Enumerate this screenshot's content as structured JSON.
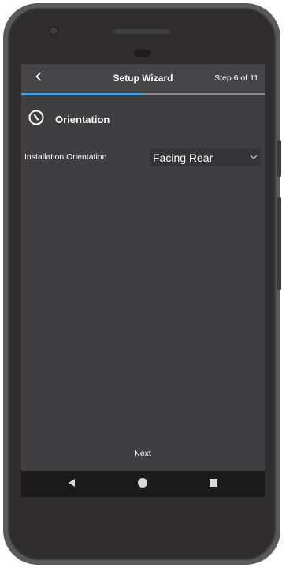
{
  "header": {
    "title": "Setup Wizard",
    "step": "Step 6 of 11",
    "back_icon": "chevron-left-icon"
  },
  "progress": {
    "current_step": 6,
    "total_steps": 11,
    "fraction": 0.5,
    "fill_color": "#4a9fd8"
  },
  "section": {
    "icon": "compass-icon",
    "title": "Orientation"
  },
  "field": {
    "label": "Installation Orientation",
    "value": "Facing Rear",
    "chevron_icon": "chevron-down-icon"
  },
  "footer": {
    "next_label": "Next"
  },
  "nav_bar": {
    "back_icon": "nav-back-icon",
    "home_icon": "nav-home-icon",
    "recents_icon": "nav-recents-icon"
  },
  "colors": {
    "screen_bg": "#3f3f41",
    "header_bg": "#464648",
    "accent": "#4a9fd8",
    "nav_bg": "#1b1b1b"
  }
}
